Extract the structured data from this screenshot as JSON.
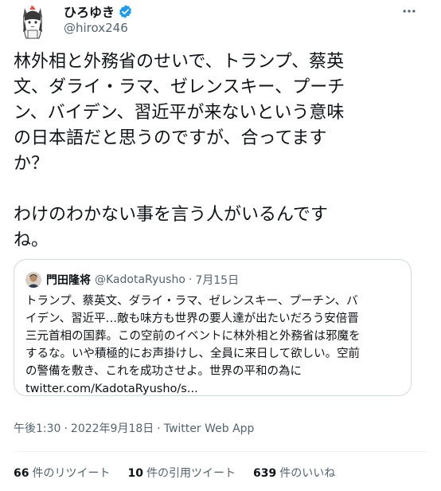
{
  "author": {
    "display_name": "ひろゆき",
    "handle": "@hirox246",
    "verified": true
  },
  "tweet": {
    "text": "林外相と外務省のせいで、トランプ、蔡英\n文、ダライ・ラマ、ゼレンスキー、プーチ\nン、バイデン、習近平が来ないという意味\nの日本語だと思うのですが、合ってます\nか？\n\nわけのわかない事を言う人がいるんです\nね。"
  },
  "quoted_tweet": {
    "display_name": "門田隆将",
    "handle": "@KadotaRyusho",
    "separator": "·",
    "date": "7月15日",
    "text": "トランプ、蔡英文、ダライ・ラマ、ゼレンスキー、プーチン、バ\nイデン、習近平…敵も味方も世界の要人達が出たいだろう安倍晋\n三元首相の国葬。この空前のイベントに林外相と外務省は邪魔を\nするな。いや積極的にお声掛けし、全員に来日して欲しい。空前\nの警備を敷き、これを成功させよ。世界の平和の為に\ntwitter.com/KadotaRyusho/s..."
  },
  "meta": {
    "time": "午後1:30",
    "separator": "·",
    "date": "2022年9月18日",
    "source": "Twitter Web App"
  },
  "stats": {
    "retweets_count": "66",
    "retweets_label": "件のリツイート",
    "quotes_count": "10",
    "quotes_label": "件の引用ツイート",
    "likes_count": "639",
    "likes_label": "件のいいね"
  },
  "colors": {
    "verified": "#1d9bf0",
    "text": "#0f1419",
    "secondary": "#536471",
    "border": "#cfd9de"
  },
  "icons": {
    "verified": "verified-badge-icon",
    "more": "more-options-icon"
  }
}
